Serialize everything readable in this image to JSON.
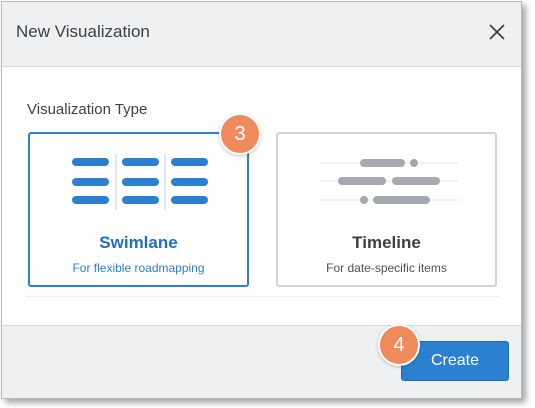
{
  "dialog": {
    "title": "New Visualization",
    "close_icon": "close-icon",
    "section_label": "Visualization Type",
    "options": [
      {
        "title": "Swimlane",
        "subtitle": "For flexible roadmapping",
        "selected": true,
        "icon": "swimlane-illustration"
      },
      {
        "title": "Timeline",
        "subtitle": "For date-specific items",
        "selected": false,
        "icon": "timeline-illustration"
      }
    ],
    "create_label": "Create"
  },
  "annotations": {
    "step3": "3",
    "step4": "4"
  },
  "colors": {
    "accent": "#2b80d2",
    "badge": "#ee8a5b",
    "header_bg": "#eef0f2",
    "timeline_bar": "#a5a8ae"
  }
}
